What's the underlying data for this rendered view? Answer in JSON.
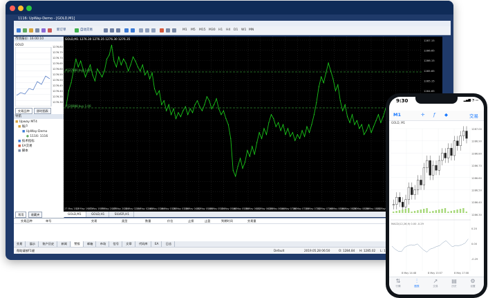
{
  "window": {
    "title": "1116: UpWay-Demo - [GOLD,M1]",
    "menu": [
      "文件(F)",
      "視圖(V)",
      "插入(I)",
      "圖表(C)",
      "工具(T)",
      "窗口(W)",
      "幫助(H)"
    ],
    "toolbar": {
      "new_order": "新订单",
      "auto_trading": "自动交易",
      "timeframes": [
        "M1",
        "M5",
        "M15",
        "M30",
        "H1",
        "H4",
        "D1",
        "W1",
        "MN"
      ]
    },
    "colors": {
      "chart_bg": "#000000",
      "candle_up": "#00ff00",
      "accent": "#1677ff"
    }
  },
  "market_watch": {
    "header": "市场报价: 16:00:10",
    "symbol": "GOLD",
    "price_labels": [
      "1276.80",
      "1276.75",
      "1276.70",
      "1276.65",
      "1276.60",
      "1276.55",
      "1276.50",
      "1276.45",
      "1276.40",
      "1276.35",
      "1276.30"
    ],
    "tabs": [
      "交易品种",
      "即时图表"
    ]
  },
  "navigator": {
    "header": "导航",
    "items": [
      {
        "label": "Upway MT4",
        "icon": "folder-icon"
      },
      {
        "label": "账户",
        "icon": "folder-icon"
      },
      {
        "label": "UpWay-Demo",
        "icon": "account-icon"
      },
      {
        "label": "1116: 1116",
        "icon": "user-icon"
      },
      {
        "label": "技术指标",
        "icon": "indicator-icon"
      },
      {
        "label": "EA交易",
        "icon": "expert-icon"
      },
      {
        "label": "脚本",
        "icon": "script-icon"
      }
    ],
    "tabs": [
      "常用",
      "收藏夹"
    ]
  },
  "chart": {
    "label": "GOLD,M1  1276.30 1276.35 1276.30 1276.35",
    "bid_line": "#127080 buy 1.00",
    "ask_line": "#126988 buy 1.00",
    "y_labels": [
      "1287.15",
      "1286.65",
      "1286.15",
      "1285.65",
      "1285.15",
      "1284.65",
      "1284.15",
      "1283.65",
      "1283.15",
      "1282.65",
      "1282.15",
      "1281.65",
      "1281.15",
      "1280.65",
      "1280.15",
      "1279.65",
      "1279.15"
    ],
    "x_labels": [
      "27 May 2019",
      "27 May 19:00",
      "27 May 19:56",
      "27 May 20:08",
      "27 May 20:24",
      "28 May 02:14",
      "28 May 02:48",
      "28 May 03:04",
      "28 May 03:20",
      "28 May 03:36",
      "28 May 04:52",
      "28 May 05:08",
      "28 May 05:24",
      "28 May 05:40",
      "28 May 05:56",
      "28 May 06:12",
      "28 May 06:28",
      "28 May 06:44",
      "28 May 07:00",
      "28 May 07:16",
      "28 May 07:32",
      "28 May 07:48",
      "28 May 08:04",
      "28 May 08:20",
      "28 May 08:36",
      "28 May 08:52",
      "28 May 09:08",
      "28 May 09:24",
      "28 May 09:40",
      "28 May 09:56"
    ],
    "tabs": [
      "GOLD,M1",
      "GOLD,H1",
      "SILVER,H1"
    ],
    "chart_data": {
      "type": "line",
      "series": [
        {
          "values": [
            1283.9,
            1284.6,
            1285.0,
            1285.6,
            1286.2,
            1285.8,
            1286.1,
            1285.7,
            1285.3,
            1285.6,
            1285.9,
            1285.4,
            1285.1,
            1285.7,
            1285.5,
            1285.3,
            1285.6,
            1286.2,
            1286.4,
            1286.9,
            1286.1,
            1285.8,
            1286.3,
            1285.9,
            1286.2,
            1286.0,
            1285.6,
            1285.9,
            1286.3,
            1286.1,
            1285.8,
            1285.6,
            1285.9,
            1285.4,
            1285.6,
            1285.2,
            1285.5,
            1284.7,
            1284.4,
            1284.6,
            1283.9,
            1284.1,
            1283.6,
            1283.9,
            1283.4,
            1283.7,
            1283.2,
            1283.5,
            1283.3,
            1283.6,
            1283.8,
            1283.4,
            1283.7,
            1283.5,
            1283.9,
            1284.1,
            1283.8,
            1283.6,
            1283.9,
            1284.3,
            1284.1,
            1283.7,
            1283.9,
            1284.2,
            1283.7,
            1283.4,
            1283.6,
            1283.2,
            1282.9,
            1282.2,
            1280.6,
            1280.3,
            1280.8,
            1281.2,
            1280.7,
            1281.0,
            1281.6,
            1281.3,
            1281.8,
            1281.4,
            1282.0,
            1282.5,
            1282.2,
            1282.7,
            1282.4,
            1283.0,
            1283.4,
            1283.2,
            1282.8,
            1283.0,
            1282.6,
            1282.9,
            1282.4,
            1282.7,
            1282.3,
            1282.5,
            1282.1,
            1282.4,
            1282.2,
            1282.6,
            1282.3,
            1282.8,
            1282.5,
            1282.9,
            1283.4,
            1284.0,
            1284.8,
            1285.3,
            1285.0,
            1285.5,
            1286.0,
            1285.6,
            1285.2,
            1284.6,
            1284.9,
            1284.1,
            1283.6,
            1283.9,
            1283.3,
            1283.0,
            1283.4,
            1282.9,
            1283.1,
            1282.7,
            1282.9,
            1282.4,
            1282.6,
            1282.9,
            1282.5,
            1282.8,
            1283.1,
            1283.4,
            1283.0,
            1283.3,
            1283.7,
            1283.5,
            1283.8,
            1284.1,
            1283.7,
            1283.9,
            1283.5,
            1283.8,
            1284.0,
            1283.6,
            1283.4,
            1283.7,
            1283.2,
            1283.5,
            1283.3
          ]
        }
      ],
      "ylim": [
        1279.15,
        1287.15
      ]
    }
  },
  "terminal": {
    "columns": [
      "交易品种",
      "单号",
      "交易",
      "类型",
      "数量",
      "价位",
      "止损",
      "止盈",
      "到期时间",
      "交易量"
    ],
    "tabs": [
      "交易",
      "展示",
      "账户历史",
      "新闻",
      "警报",
      "邮箱",
      "市场",
      "信号",
      "文章",
      "代码库",
      "EA",
      "日志"
    ],
    "active_tab": "警报"
  },
  "status": {
    "help": "帮助请按F1键",
    "profile": "Default",
    "datetime": "2019.05.28 06:50",
    "open": "O: 1284.84",
    "high": "H: 1285.02",
    "low": "L: 1284.80",
    "close": "C: 1284.94"
  },
  "phone": {
    "time": "9:30",
    "signal": "▂▄▆ ◔ ▭",
    "timeframe": "M1",
    "trade_label": "交易",
    "symbol": "GOLD, M1",
    "price_labels": [
      "1287.00",
      "1286.90",
      "1286.80",
      "1286.70",
      "1286.60",
      "1286.50",
      "1286.40",
      "1286.30"
    ],
    "indicator_label": "MACD(12,26,9) 0.00 -0.29",
    "indicator_levels": [
      "0.20",
      "0.00",
      "-0.29"
    ],
    "x_labels": [
      "8 May 14:48",
      "8 May 15:57",
      "8 May 17:08"
    ],
    "bottom_nav": [
      {
        "label": "行情",
        "icon": "quotes-icon"
      },
      {
        "label": "图表",
        "icon": "chart-icon"
      },
      {
        "label": "交易",
        "icon": "trade-icon"
      },
      {
        "label": "历史",
        "icon": "history-icon"
      },
      {
        "label": "设置",
        "icon": "settings-icon"
      }
    ],
    "active_nav": "图表",
    "chart_data": {
      "type": "bar",
      "series": [
        {
          "values": [
            1286.38,
            1286.44,
            1286.4,
            1286.36,
            1286.42,
            1286.52,
            1286.46,
            1286.5,
            1286.58,
            1286.54,
            1286.68,
            1286.74,
            1286.62,
            1286.7,
            1286.66,
            1286.74,
            1286.8,
            1286.76,
            1286.84,
            1286.78,
            1286.9,
            1286.86,
            1286.94,
            1286.98,
            1286.92
          ]
        }
      ],
      "ylim": [
        1286.3,
        1287.0
      ]
    }
  }
}
